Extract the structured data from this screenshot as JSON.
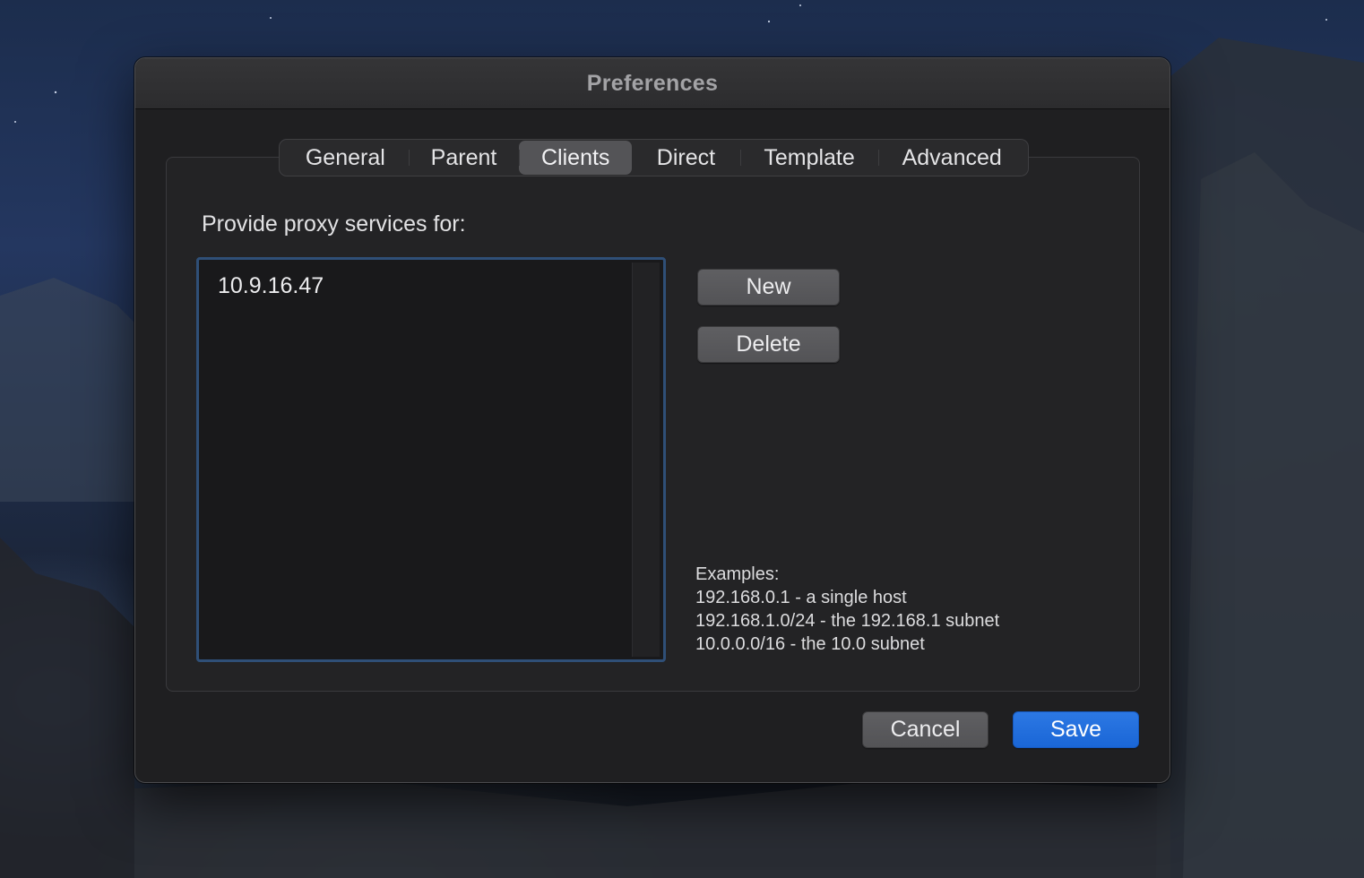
{
  "window": {
    "title": "Preferences"
  },
  "tabs": [
    {
      "label": "General",
      "active": false
    },
    {
      "label": "Parent",
      "active": false
    },
    {
      "label": "Clients",
      "active": true
    },
    {
      "label": "Direct",
      "active": false
    },
    {
      "label": "Template",
      "active": false
    },
    {
      "label": "Advanced",
      "active": false
    }
  ],
  "clients": {
    "heading": "Provide proxy services for:",
    "items": [
      "10.9.16.47"
    ],
    "new_label": "New",
    "delete_label": "Delete"
  },
  "examples": {
    "heading": "Examples:",
    "lines": [
      "192.168.0.1 - a single host",
      "192.168.1.0/24 - the 192.168.1 subnet",
      "10.0.0.0/16 - the 10.0 subnet"
    ]
  },
  "footer": {
    "cancel_label": "Cancel",
    "save_label": "Save"
  },
  "colors": {
    "accent": "#1a66d6",
    "focus_ring": "#2f4f77"
  }
}
